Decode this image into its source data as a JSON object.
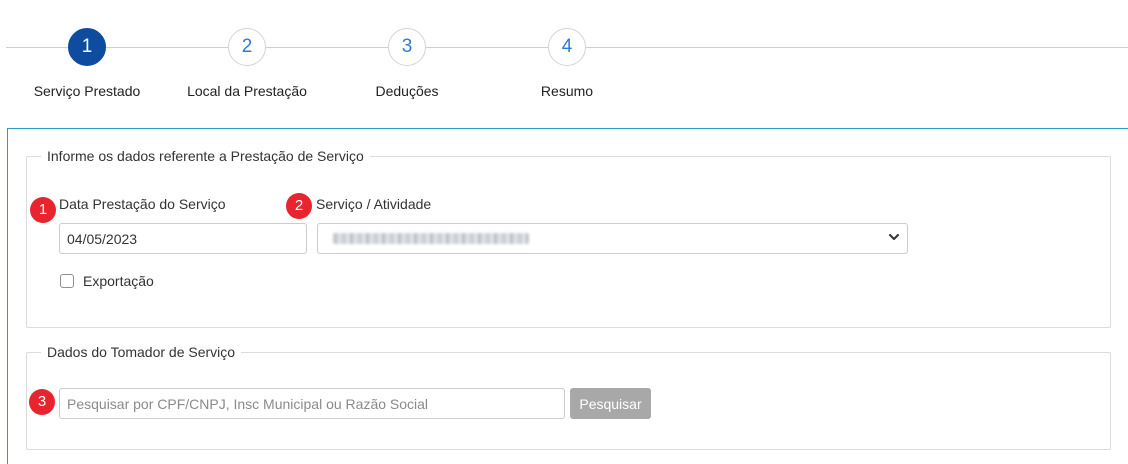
{
  "stepper": {
    "steps": [
      {
        "number": "1",
        "label": "Serviço Prestado",
        "active": true
      },
      {
        "number": "2",
        "label": "Local da Prestação",
        "active": false
      },
      {
        "number": "3",
        "label": "Deduções",
        "active": false
      },
      {
        "number": "4",
        "label": "Resumo",
        "active": false
      }
    ]
  },
  "service_section": {
    "legend": "Informe os dados referente a Prestação de Serviço",
    "date_label": "Data Prestação do Serviço",
    "date_value": "04/05/2023",
    "service_label": "Serviço / Atividade",
    "export_label": "Exportação",
    "badges": [
      "1",
      "2"
    ]
  },
  "client_section": {
    "legend": "Dados do Tomador de Serviço",
    "search_placeholder": "Pesquisar por CPF/CNPJ, Insc Municipal ou Razão Social",
    "search_button": "Pesquisar",
    "badge": "3"
  },
  "colors": {
    "step_active": "#0d4c9f",
    "step_number": "#2d7bd6",
    "badge": "#e8242f",
    "panel_border": "#2a9dc7",
    "button_disabled": "#a8a8a8"
  }
}
